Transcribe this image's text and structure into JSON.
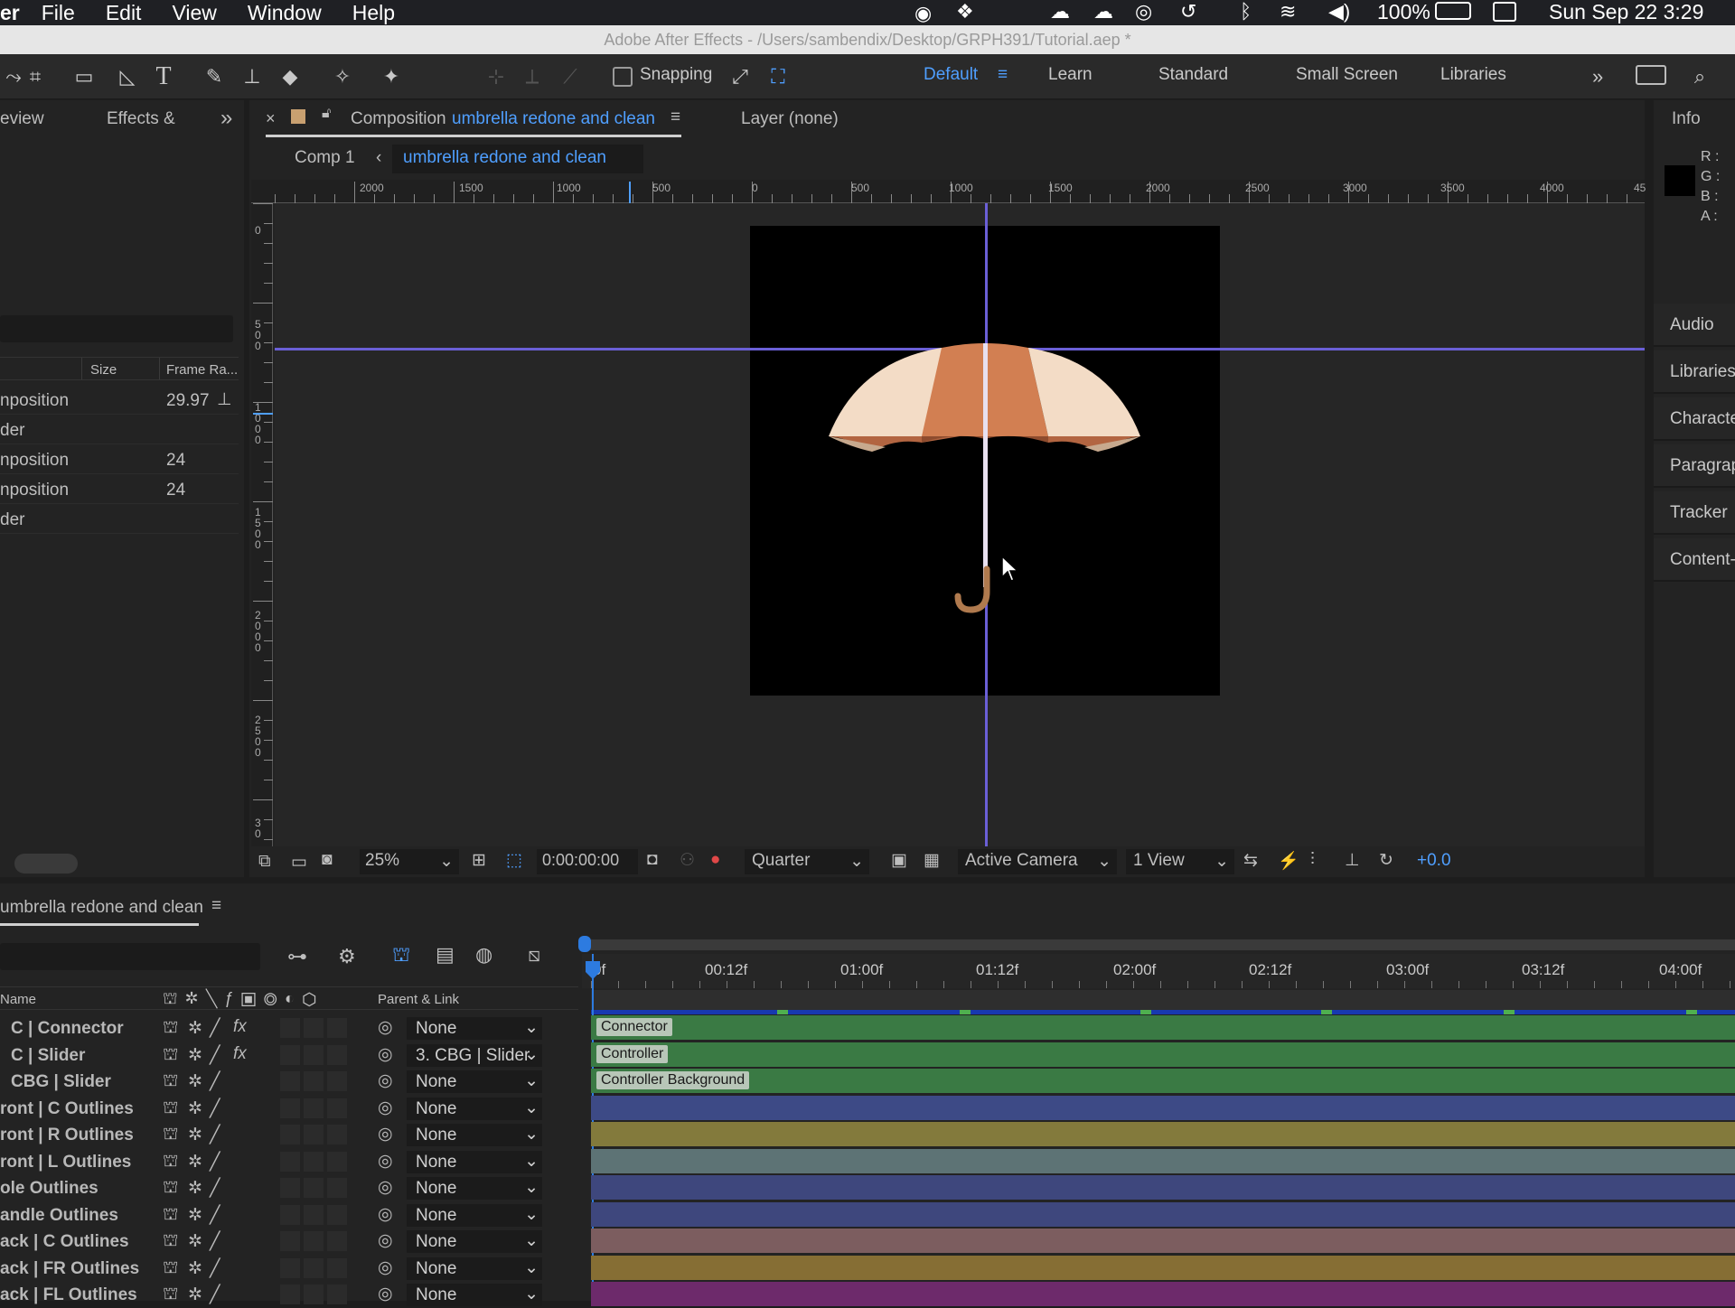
{
  "menubar": {
    "app": "er",
    "items": [
      "File",
      "Edit",
      "View",
      "Window",
      "Help"
    ],
    "battery": "100%",
    "clock": "Sun Sep 22  3:29"
  },
  "titlebar": {
    "text": "Adobe After Effects - /Users/sambendix/Desktop/GRPH391/Tutorial.aep *"
  },
  "toolbar": {
    "snapping": "Snapping",
    "workspaces": [
      "Default",
      "Learn",
      "Standard",
      "Small Screen",
      "Libraries"
    ]
  },
  "project": {
    "tab_preview": "eview",
    "tab_effects": "Effects &",
    "col_size": "Size",
    "col_framerate": "Frame Ra...",
    "items": [
      {
        "name": "nposition",
        "fps": "29.97"
      },
      {
        "name": "der",
        "fps": ""
      },
      {
        "name": "nposition",
        "fps": "24"
      },
      {
        "name": "nposition",
        "fps": "24"
      },
      {
        "name": "der",
        "fps": ""
      }
    ]
  },
  "comp": {
    "tab_prefix": "Composition",
    "tab_name": "umbrella redone and clean",
    "layer_tab": "Layer (none)",
    "crumb1": "Comp 1",
    "crumb2": "umbrella redone and clean",
    "ruler_labels": [
      "2000",
      "1500",
      "1000",
      "500",
      "0",
      "500",
      "1000",
      "1500",
      "2000",
      "2500",
      "3000",
      "3500",
      "4000",
      "45"
    ],
    "vruler_labels": [
      "0",
      "5\n0\n0",
      "1\n0\n0\n0",
      "1\n5\n0\n0",
      "2\n0\n0\n0",
      "2\n5\n0\n0",
      "3\n0"
    ],
    "zoom": "25%",
    "timecode": "0:00:00:00",
    "resolution": "Quarter",
    "camera": "Active Camera",
    "views": "1 View",
    "exposure": "+0.0"
  },
  "info": {
    "title": "Info",
    "r": "R :",
    "g": "G :",
    "b": "B :",
    "a": "A :",
    "panels": [
      "Audio",
      "Libraries",
      "Characte",
      "Paragrap",
      "Tracker",
      "Content-"
    ]
  },
  "timeline": {
    "tab": "umbrella redone and clean",
    "col_name": "Name",
    "col_parent": "Parent & Link",
    "times": [
      "0f",
      "00:12f",
      "01:00f",
      "01:12f",
      "02:00f",
      "02:12f",
      "03:00f",
      "03:12f",
      "04:00f"
    ],
    "layers": [
      {
        "name": "C | Connector",
        "parent": "None",
        "fx": true,
        "color": "#3a7a44",
        "label": "Connector"
      },
      {
        "name": "C | Slider",
        "parent": "3. CBG | Slider",
        "fx": true,
        "color": "#3a7a44",
        "label": "Controller"
      },
      {
        "name": "CBG | Slider",
        "parent": "None",
        "fx": false,
        "color": "#3a7a44",
        "label": "Controller Background"
      },
      {
        "name": "ront | C Outlines",
        "parent": "None",
        "fx": false,
        "color": "#3d4a86",
        "label": ""
      },
      {
        "name": "ront | R Outlines",
        "parent": "None",
        "fx": false,
        "color": "#837a3c",
        "label": ""
      },
      {
        "name": "ront | L Outlines",
        "parent": "None",
        "fx": false,
        "color": "#5d7375",
        "label": ""
      },
      {
        "name": "ole Outlines",
        "parent": "None",
        "fx": false,
        "color": "#3e477d",
        "label": ""
      },
      {
        "name": "andle Outlines",
        "parent": "None",
        "fx": false,
        "color": "#3e477d",
        "label": ""
      },
      {
        "name": "ack | C Outlines",
        "parent": "None",
        "fx": false,
        "color": "#7c5d5f",
        "label": ""
      },
      {
        "name": "ack | FR Outlines",
        "parent": "None",
        "fx": false,
        "color": "#866e34",
        "label": ""
      },
      {
        "name": "ack | FL Outlines",
        "parent": "None",
        "fx": false,
        "color": "#6d2a6b",
        "label": ""
      }
    ]
  }
}
